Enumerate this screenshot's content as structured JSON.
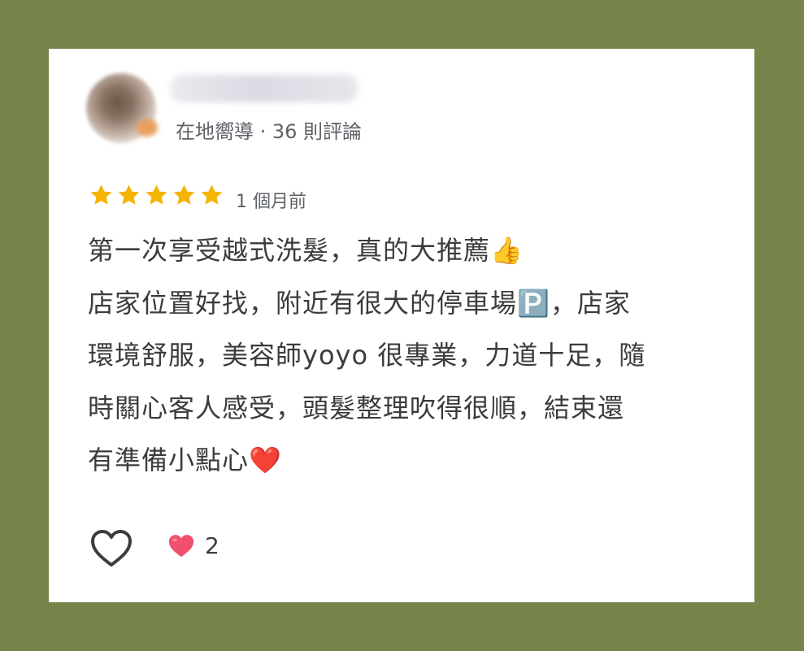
{
  "reviewer": {
    "name": "",
    "meta": "在地嚮導 · 36 則評論"
  },
  "rating": {
    "stars": 5,
    "max": 5,
    "time": "1 個月前"
  },
  "review": {
    "lines": [
      "第一次享受越式洗髮，真的大推薦👍",
      "店家位置好找，附近有很大的停車場🅿️，店家",
      "環境舒服，美容師yoyo 很專業，力道十足，隨",
      "時關心客人感受，頭髮整理吹得很順，結束還",
      "有準備小點心❤️"
    ]
  },
  "reactions": {
    "like_icon": "heart-outline-icon",
    "heart_icon": "heart-icon",
    "count": "2"
  },
  "colors": {
    "background": "#758549",
    "card": "#ffffff",
    "star": "#f4b400",
    "heart": "#f0506e"
  }
}
